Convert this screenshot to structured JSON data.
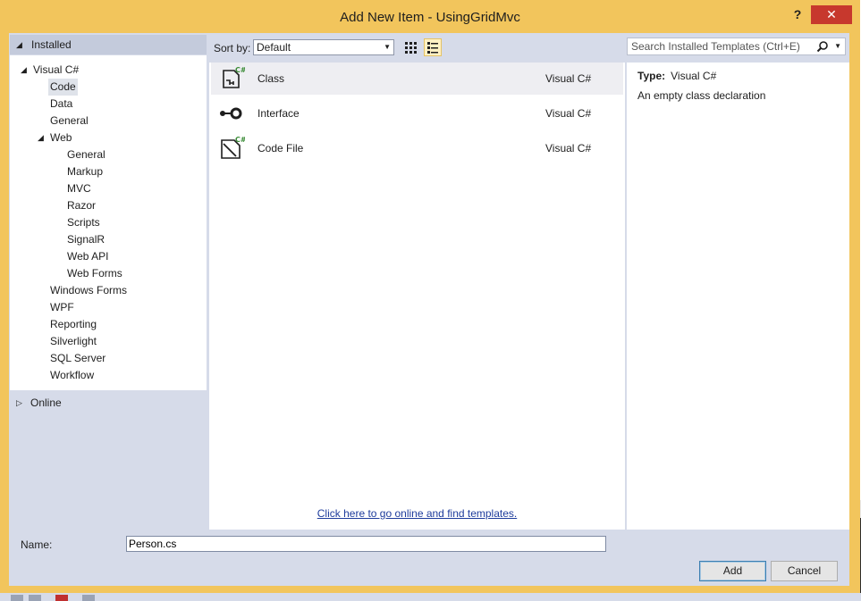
{
  "window": {
    "title": "Add New Item - UsingGridMvc",
    "help_label": "?",
    "close_label": "✕"
  },
  "left_panel": {
    "installed_label": "Installed",
    "online_label": "Online",
    "tree": [
      {
        "label": "Visual C#",
        "level": 0,
        "expanded": true
      },
      {
        "label": "Code",
        "level": 1,
        "selected": true
      },
      {
        "label": "Data",
        "level": 1
      },
      {
        "label": "General",
        "level": 1
      },
      {
        "label": "Web",
        "level": 1,
        "expanded": true
      },
      {
        "label": "General",
        "level": 2
      },
      {
        "label": "Markup",
        "level": 2
      },
      {
        "label": "MVC",
        "level": 2
      },
      {
        "label": "Razor",
        "level": 2
      },
      {
        "label": "Scripts",
        "level": 2
      },
      {
        "label": "SignalR",
        "level": 2
      },
      {
        "label": "Web API",
        "level": 2
      },
      {
        "label": "Web Forms",
        "level": 2
      },
      {
        "label": "Windows Forms",
        "level": 1
      },
      {
        "label": "WPF",
        "level": 1
      },
      {
        "label": "Reporting",
        "level": 1
      },
      {
        "label": "Silverlight",
        "level": 1
      },
      {
        "label": "SQL Server",
        "level": 1
      },
      {
        "label": "Workflow",
        "level": 1
      }
    ]
  },
  "toolbar": {
    "sort_label": "Sort by:",
    "sort_value": "Default",
    "search_placeholder": "Search Installed Templates (Ctrl+E)"
  },
  "templates": [
    {
      "name": "Class",
      "type": "Visual C#",
      "icon": "class-icon",
      "selected": true
    },
    {
      "name": "Interface",
      "type": "Visual C#",
      "icon": "interface-icon"
    },
    {
      "name": "Code File",
      "type": "Visual C#",
      "icon": "code-file-icon"
    }
  ],
  "online_link": "Click here to go online and find templates.",
  "details": {
    "type_label": "Type:",
    "type_value": "Visual C#",
    "description": "An empty class declaration"
  },
  "bottom": {
    "name_label": "Name:",
    "name_value": "Person.cs",
    "add_label": "Add",
    "cancel_label": "Cancel"
  },
  "colors": {
    "frame": "#f2c55c",
    "close": "#c7382d",
    "panel": "#d6dbe9",
    "link": "#1e3c9c"
  }
}
